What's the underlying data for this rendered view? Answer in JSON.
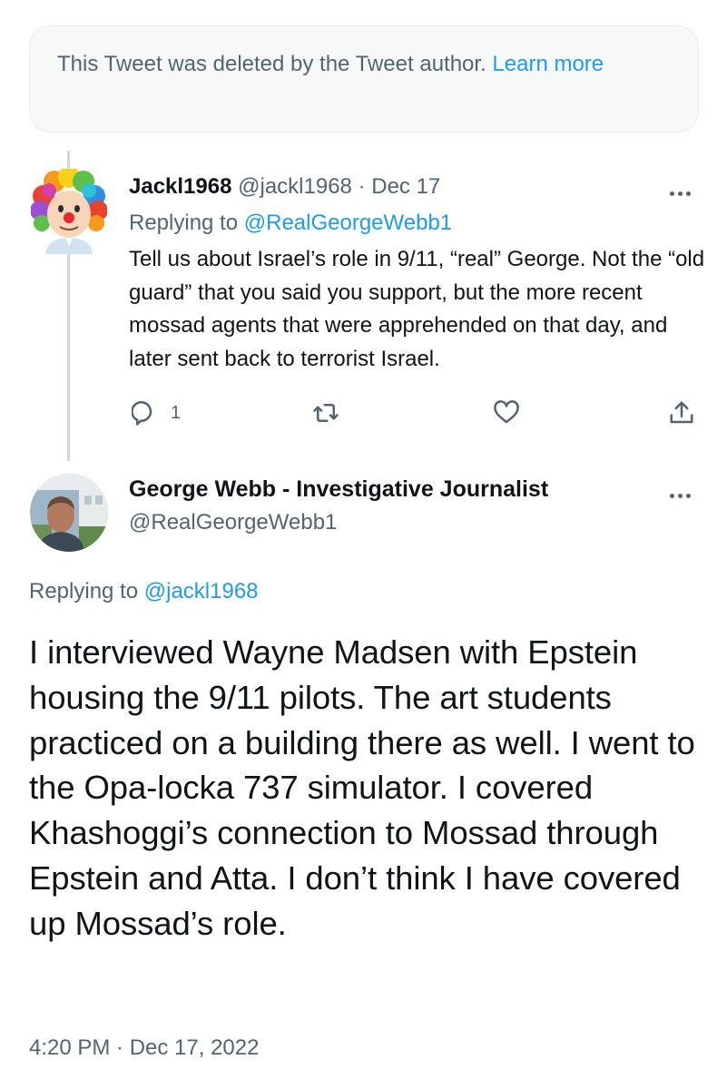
{
  "deleted_notice": {
    "text": "This Tweet was deleted by the Tweet author.",
    "link": "Learn more"
  },
  "reply_tweet": {
    "author_name": "Jackl1968",
    "author_handle": "@jackl1968",
    "separator": "·",
    "date": "Dec 17",
    "replying_prefix": "Replying to",
    "replying_handle": "@RealGeorgeWebb1",
    "text": "Tell us about Israel’s role in 9/11, “real” George. Not the “old guard” that you said you support, but the more recent mossad agents that were apprehended on that day, and later sent back to terrorist Israel.",
    "reply_count": "1",
    "avatar_icon": "clown-avatar-icon"
  },
  "main_tweet": {
    "author_name": "George Webb - Investigative Journalist",
    "author_handle": "@RealGeorgeWebb1",
    "replying_prefix": "Replying to",
    "replying_handle": "@jackl1968",
    "text": "I interviewed Wayne Madsen with Epstein housing the 9/11 pilots. The art students practiced on a building there as well. I went to the Opa-locka 737 simulator. I covered Khashoggi’s connection to Mossad through Epstein and Atta. I don’t think I have covered up Mossad’s role.",
    "timestamp": "4:20 PM · Dec 17, 2022"
  },
  "colors": {
    "accent": "#1d9bf0",
    "secondary_text": "#536471",
    "primary_text": "#0f1419",
    "notice_bg": "#f7f9f9"
  }
}
